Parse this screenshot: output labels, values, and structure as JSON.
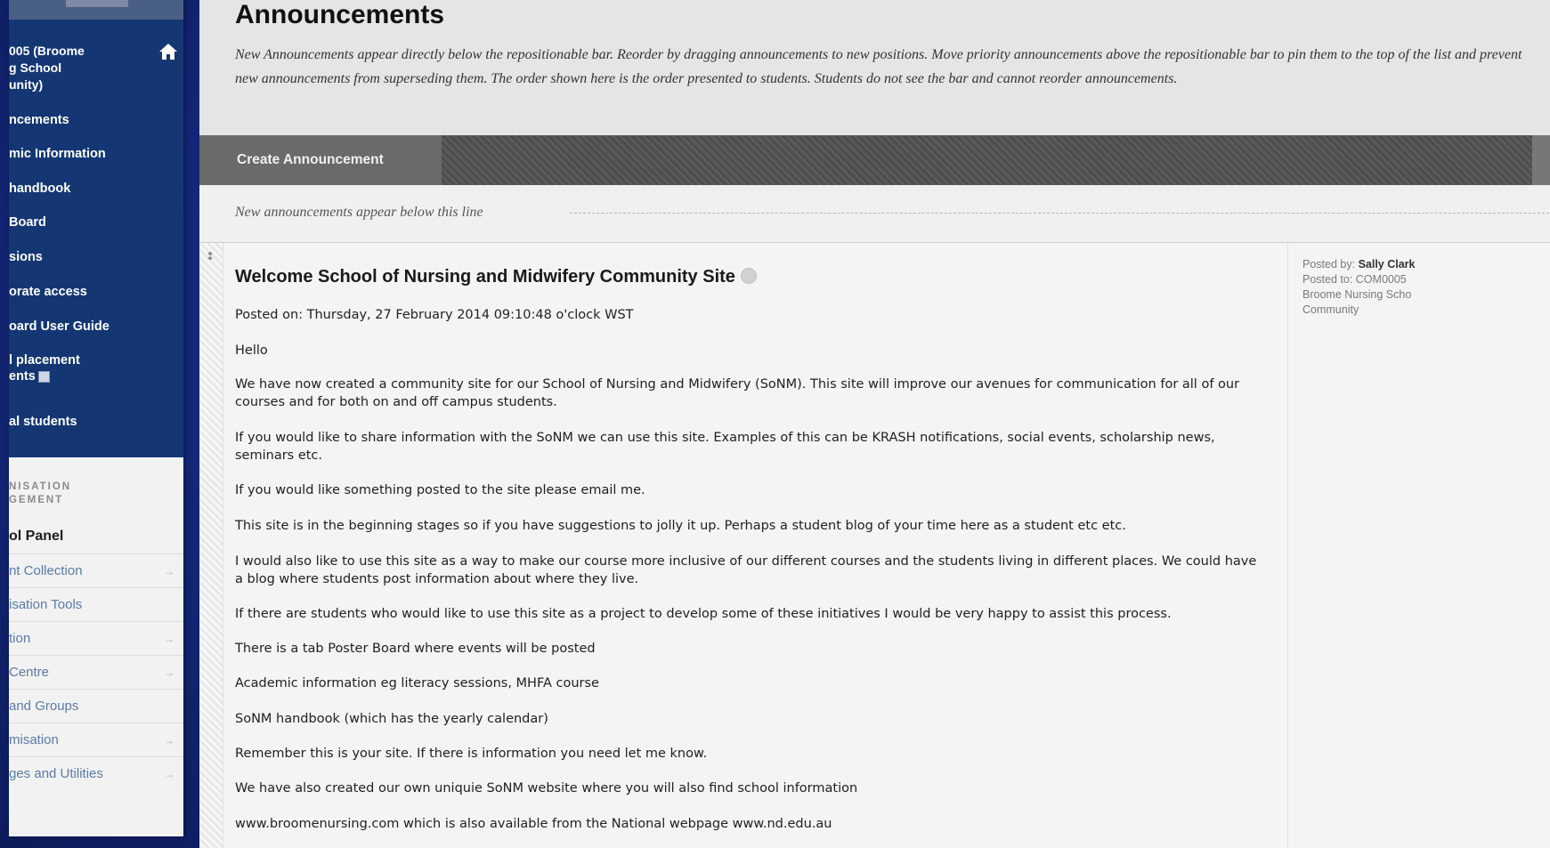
{
  "sidebar": {
    "course_title": "005 (Broome\ng School\nunity)",
    "nav_items": [
      {
        "label": "ncements"
      },
      {
        "label": "mic Information"
      },
      {
        "label": "handbook"
      },
      {
        "label": "Board"
      },
      {
        "label": "sions"
      },
      {
        "label": "orate access"
      },
      {
        "label": "oard User Guide"
      },
      {
        "label": "l placement\nents"
      },
      {
        "label": "al students"
      }
    ],
    "management_heading": "NISATION\nGEMENT",
    "control_panel_label": "ol Panel",
    "control_panel_items": [
      {
        "label": "nt Collection",
        "has_arrow": true
      },
      {
        "label": "isation Tools",
        "has_arrow": false
      },
      {
        "label": "tion",
        "has_arrow": true
      },
      {
        "label": "Centre",
        "has_arrow": true
      },
      {
        "label": "and Groups",
        "has_arrow": false
      },
      {
        "label": "misation",
        "has_arrow": true
      },
      {
        "label": "ges and Utilities",
        "has_arrow": true
      }
    ]
  },
  "header": {
    "title": "Announcements",
    "description": "New Announcements appear directly below the repositionable bar. Reorder by dragging announcements to new positions. Move priority announcements above the repositionable bar to pin them to the top of the list and prevent new announcements from superseding them. The order shown here is the order presented to students. Students do not see the bar and cannot reorder announcements."
  },
  "toolbar": {
    "create_label": "Create Announcement"
  },
  "divider": {
    "label": "New announcements appear below this line"
  },
  "announcement": {
    "title": "Welcome School of Nursing and Midwifery Community Site",
    "posted_on": "Posted on: Thursday, 27 February 2014 09:10:48 o'clock WST",
    "paragraphs": [
      "Hello",
      "We have now created a community site for our School of Nursing and Midwifery (SoNM). This site will improve our avenues for communication for all of our courses and for both on and off campus students.",
      "If you would like to share information with the SoNM we can use this site. Examples of this can be KRASH notifications, social events, scholarship news, seminars etc.",
      "If you would like something posted to the site please email me.",
      "This site is in the beginning stages so if you have suggestions to jolly it up. Perhaps a student blog of your time here as a student etc etc.",
      "I would also like to use this site as a way to make our course more inclusive of our different courses and the students living in different places. We could have a blog where students post information about where they live.",
      "If there are students who would like to use this site as a project to develop some of these initiatives I would be very happy to assist this process.",
      "There is a tab Poster Board where events will be posted",
      "Academic information eg literacy sessions, MHFA course",
      "SoNM handbook (which has the yearly calendar)",
      "Remember this is your site. If there is information you need let me know.",
      "We have also created our own uniquie SoNM website where you will also find school information",
      "www.broomenursing.com which is also available from the National webpage www.nd.edu.au"
    ],
    "meta": {
      "posted_by_label": "Posted by:",
      "posted_by_name": "Sally Clark",
      "posted_to_label": "Posted to:",
      "posted_to_value": "COM0005",
      "posted_to_cont": "Broome Nursing Scho",
      "posted_to_cont2": "Community"
    }
  },
  "colors": {
    "sidebar_dark": "#143774",
    "page_background": "#1a3388",
    "toolbar": "#5a5a5a",
    "link_text": "#5b7aa6"
  }
}
